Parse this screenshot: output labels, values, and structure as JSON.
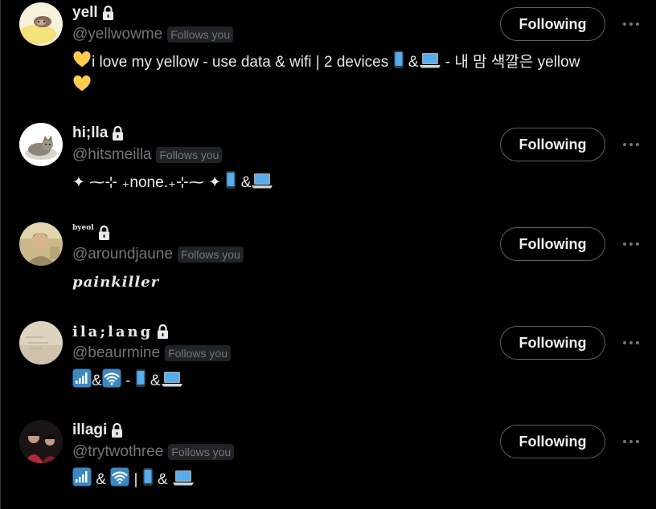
{
  "users": [
    {
      "name": "yell",
      "handle": "@yellwowme",
      "follows_you": "Follows you",
      "bio_text_1": "i love my yellow - use data & wifi | 2 devices ",
      "bio_text_2": "&",
      "bio_text_3": " - 내 맘 색깔은 yellow",
      "follow_label": "Following"
    },
    {
      "name": "hi;lla",
      "handle": "@hitsmeilla",
      "follows_you": "Follows you",
      "bio_text_1": "✦ ⁓⊹ ₊none.₊⊹⁓ ✦ ",
      "bio_text_2": "&",
      "follow_label": "Following"
    },
    {
      "name": "byeol",
      "handle": "@aroundjaune",
      "follows_you": "Follows you",
      "bio_text_1": "painkiller",
      "follow_label": "Following"
    },
    {
      "name": "ila;lang",
      "handle": "@beaurmine",
      "follows_you": "Follows you",
      "bio_text_1": "&",
      "bio_text_2": " - ",
      "bio_text_3": "&",
      "follow_label": "Following"
    },
    {
      "name": "illagi",
      "handle": "@trytwothree",
      "follows_you": "Follows you",
      "bio_text_1": " & ",
      "bio_text_2": " | ",
      "bio_text_3": " & ",
      "follow_label": "Following"
    }
  ],
  "icons": {
    "lock": "lock-icon",
    "more": "more-icon",
    "heart": "yellow-heart-emoji",
    "phone": "mobile-phone-emoji",
    "laptop": "laptop-emoji",
    "signal": "signal-bars-emoji",
    "wifi": "wifi-emoji"
  },
  "colors": {
    "background": "#000000",
    "text": "#e7e9ea",
    "secondary": "#71767b",
    "badge_bg": "#202327",
    "button_border": "#536471",
    "heart": "#ffcc4d",
    "emoji_blue": "#3b88c3"
  }
}
